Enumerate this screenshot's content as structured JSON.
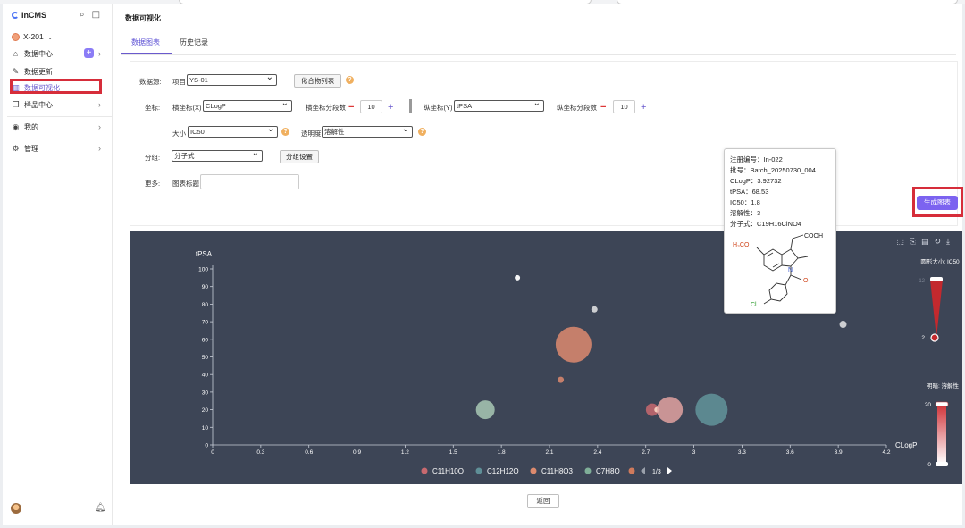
{
  "sidebar": {
    "brand": "InCMS",
    "workspace": "X-201",
    "items": [
      {
        "label": "数据中心",
        "icon": "home-icon"
      },
      {
        "label": "数据更新",
        "icon": "pencil-icon"
      },
      {
        "label": "数据可视化",
        "icon": "bar-chart-icon"
      },
      {
        "label": "样品中心",
        "icon": "box-icon"
      },
      {
        "label": "我的",
        "icon": "user-circle-icon"
      },
      {
        "label": "管理",
        "icon": "gear-icon"
      }
    ],
    "plus_badge": "+"
  },
  "header": {
    "title": "数据可视化"
  },
  "tabs": [
    {
      "label": "数据图表"
    },
    {
      "label": "历史记录"
    }
  ],
  "form": {
    "source_label": "数据源:",
    "project_label": "项目",
    "project_value": "YS-01",
    "compound_list_button": "化合物列表",
    "coord_label": "坐标:",
    "x_axis_label": "横坐标(X)",
    "x_axis_value": "CLogP",
    "x_segments_label": "横坐标分段数",
    "x_segments_value": "10",
    "y_axis_label": "纵坐标(Y)",
    "y_axis_value": "tPSA",
    "y_segments_label": "纵坐标分段数",
    "y_segments_value": "10",
    "size_label": "大小",
    "size_value": "IC50",
    "opacity_label": "透明度",
    "opacity_value": "溶解性",
    "group_label": "分组:",
    "group_value": "分子式",
    "group_settings_button": "分组设置",
    "more_label": "更多:",
    "chart_title_label": "图表标题",
    "chart_title_value": "",
    "generate_button": "生成图表"
  },
  "colors": {
    "accent": "#7c63f0",
    "chart_bg": "#3d4556",
    "highlight": "#d62d3a",
    "s1": "#c8696f",
    "s2": "#5f8f97",
    "s3": "#dd8a6e",
    "s4": "#7fae98",
    "s5": "#cf7a5c"
  },
  "chart_data": {
    "type": "scatter",
    "xlabel": "CLogP",
    "ylabel": "tPSA",
    "xlim": [
      0,
      4.2
    ],
    "ylim": [
      0,
      100
    ],
    "x_ticks": [
      "0",
      "0.3",
      "0.6",
      "0.9",
      "1.2",
      "1.5",
      "1.8",
      "2.1",
      "2.4",
      "2.7",
      "3",
      "3.3",
      "3.6",
      "3.9",
      "4.2"
    ],
    "y_ticks": [
      "0",
      "10",
      "20",
      "30",
      "40",
      "50",
      "60",
      "70",
      "80",
      "90",
      "100"
    ],
    "legend": [
      "C11H10O",
      "C12H12O",
      "C11H8O3",
      "C7H8O"
    ],
    "legend_page": "1/3",
    "size_legend_title": "圆形大小: IC50",
    "size_legend_min": "2",
    "size_legend_max": "12",
    "opacity_legend_title": "明暗: 溶解性",
    "opacity_legend_min": "0",
    "opacity_legend_max": "20",
    "points": [
      {
        "x": 1.9,
        "y": 95,
        "r": 3,
        "color": "#ffffff",
        "opacity": 0.95
      },
      {
        "x": 2.38,
        "y": 77,
        "r": 3.5,
        "color": "#e6e6e6",
        "opacity": 0.85
      },
      {
        "x": 3.93,
        "y": 68.5,
        "r": 4,
        "color": "#e6e6e6",
        "opacity": 0.85
      },
      {
        "x": 2.25,
        "y": 57,
        "r": 20,
        "color": "#dd8a6e",
        "opacity": 0.85
      },
      {
        "x": 2.17,
        "y": 37,
        "r": 3.5,
        "color": "#dd8a6e",
        "opacity": 0.85
      },
      {
        "x": 1.7,
        "y": 20,
        "r": 10.5,
        "color": "#a8c8b4",
        "opacity": 0.85
      },
      {
        "x": 2.74,
        "y": 20,
        "r": 7,
        "color": "#c8696f",
        "opacity": 0.85
      },
      {
        "x": 2.77,
        "y": 20,
        "r": 3,
        "color": "#f7d0c0",
        "opacity": 0.95
      },
      {
        "x": 2.85,
        "y": 20,
        "r": 14.5,
        "color": "#e2a2a0",
        "opacity": 0.85
      },
      {
        "x": 3.11,
        "y": 20,
        "r": 18,
        "color": "#5f8f97",
        "opacity": 0.9
      }
    ]
  },
  "tooltip": {
    "reg_no": "注册编号：In-022",
    "batch": "批号：Batch_20250730_004",
    "clogp": "CLogP：3.92732",
    "tpsa": "tPSA：68.53",
    "ic50": "IC50：1.8",
    "solubility": "溶解性：3",
    "formula": "分子式：C19H16ClNO4",
    "struct_cooh": "COOH",
    "struct_och3": "H₃CO",
    "struct_n": "N",
    "struct_o": "O",
    "struct_cl": "Cl"
  },
  "return_button": "返回"
}
